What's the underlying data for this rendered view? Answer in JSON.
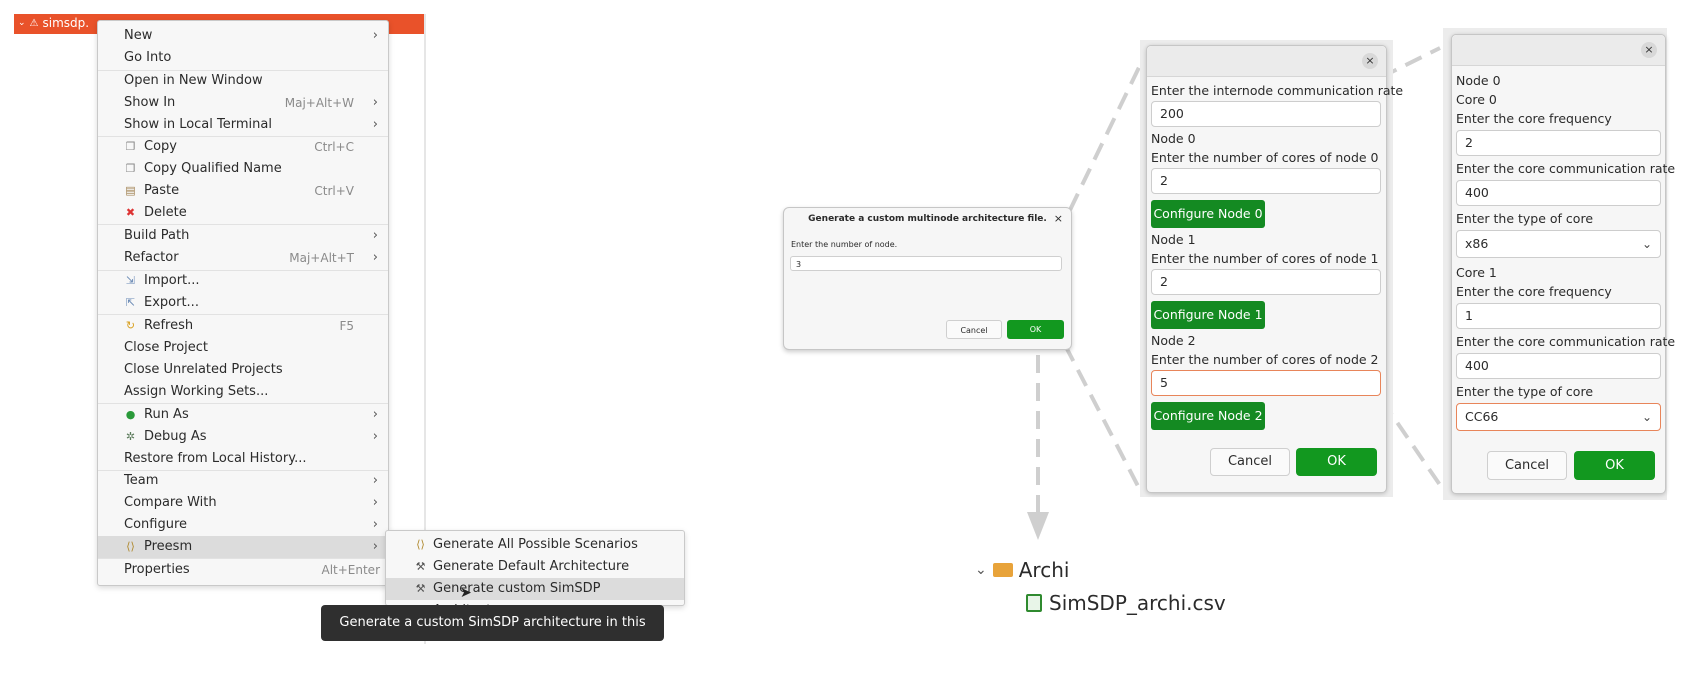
{
  "explorer": {
    "project_name": "simsdp."
  },
  "context_menu": {
    "items": [
      {
        "label": "New",
        "shortcut": "",
        "submenu": true
      },
      {
        "label": "Go Into",
        "shortcut": "",
        "submenu": false
      },
      {
        "label": "Open in New Window",
        "shortcut": "",
        "submenu": false
      },
      {
        "label": "Show In",
        "shortcut": "Maj+Alt+W",
        "submenu": true
      },
      {
        "label": "Show in Local Terminal",
        "shortcut": "",
        "submenu": true
      },
      {
        "label": "Copy",
        "shortcut": "Ctrl+C",
        "icon": "copy-icon"
      },
      {
        "label": "Copy Qualified Name",
        "shortcut": "",
        "icon": "copy-qualified-name-icon"
      },
      {
        "label": "Paste",
        "shortcut": "Ctrl+V",
        "icon": "paste-icon"
      },
      {
        "label": "Delete",
        "shortcut": "",
        "icon": "delete-icon"
      },
      {
        "label": "Build Path",
        "shortcut": "",
        "submenu": true
      },
      {
        "label": "Refactor",
        "shortcut": "Maj+Alt+T",
        "submenu": true
      },
      {
        "label": "Import...",
        "shortcut": "",
        "icon": "import-icon"
      },
      {
        "label": "Export...",
        "shortcut": "",
        "icon": "export-icon"
      },
      {
        "label": "Refresh",
        "shortcut": "F5",
        "icon": "refresh-icon"
      },
      {
        "label": "Close Project",
        "shortcut": ""
      },
      {
        "label": "Close Unrelated Projects",
        "shortcut": ""
      },
      {
        "label": "Assign Working Sets...",
        "shortcut": ""
      },
      {
        "label": "Run As",
        "shortcut": "",
        "icon": "run-icon",
        "submenu": true
      },
      {
        "label": "Debug As",
        "shortcut": "",
        "icon": "debug-icon",
        "submenu": true
      },
      {
        "label": "Restore from Local History...",
        "shortcut": ""
      },
      {
        "label": "Team",
        "shortcut": "",
        "submenu": true
      },
      {
        "label": "Compare With",
        "shortcut": "",
        "submenu": true
      },
      {
        "label": "Configure",
        "shortcut": "",
        "submenu": true
      },
      {
        "label": "Preesm",
        "shortcut": "",
        "icon": "preesm-icon",
        "submenu": true,
        "selected": true
      },
      {
        "label": "Properties",
        "shortcut": "Alt+Enter"
      }
    ]
  },
  "preesm_submenu": {
    "items": [
      {
        "label": "Generate All Possible Scenarios",
        "icon": "scenarios-icon"
      },
      {
        "label": "Generate Default Architecture",
        "icon": "wand-icon"
      },
      {
        "label": "Generate custom SimSDP Architecture",
        "icon": "wand-icon",
        "selected": true
      }
    ]
  },
  "tooltip": {
    "text": "Generate a custom SimSDP architecture in this project."
  },
  "node_count_dialog": {
    "title": "Generate a custom multinode architecture file.",
    "prompt": "Enter the number of node.",
    "value": "3",
    "cancel": "Cancel",
    "ok": "OK"
  },
  "node_dialog": {
    "close": "×",
    "internode_label": "Enter the internode communication rate",
    "internode_value": "200",
    "nodes": [
      {
        "title": "Node 0",
        "cores_label": "Enter the number of cores of node 0",
        "cores_value": "2",
        "button": "Configure Node 0"
      },
      {
        "title": "Node 1",
        "cores_label": "Enter the number of cores of node 1",
        "cores_value": "2",
        "button": "Configure Node 1"
      },
      {
        "title": "Node 2",
        "cores_label": "Enter the number of cores of node 2",
        "cores_value": "5",
        "button": "Configure Node 2"
      }
    ],
    "cancel": "Cancel",
    "ok": "OK"
  },
  "core_dialog": {
    "close": "×",
    "node_title": "Node 0",
    "cores": [
      {
        "title": "Core 0",
        "freq_label": "Enter the core frequency",
        "freq_value": "2",
        "comm_label": "Enter the core communication rate",
        "comm_value": "400",
        "type_label": "Enter the type of core",
        "type_value": "x86"
      },
      {
        "title": "Core 1",
        "freq_label": "Enter the core frequency",
        "freq_value": "1",
        "comm_label": "Enter the core communication rate",
        "comm_value": "400",
        "type_label": "Enter the type of core",
        "type_value": "CC66"
      }
    ],
    "cancel": "Cancel",
    "ok": "OK"
  },
  "file_tree": {
    "folder": "Archi",
    "file": "SimSDP_archi.csv"
  },
  "colors": {
    "selection_orange": "#e9522a",
    "green_button": "#148a22",
    "focus_border": "#e8855a"
  }
}
